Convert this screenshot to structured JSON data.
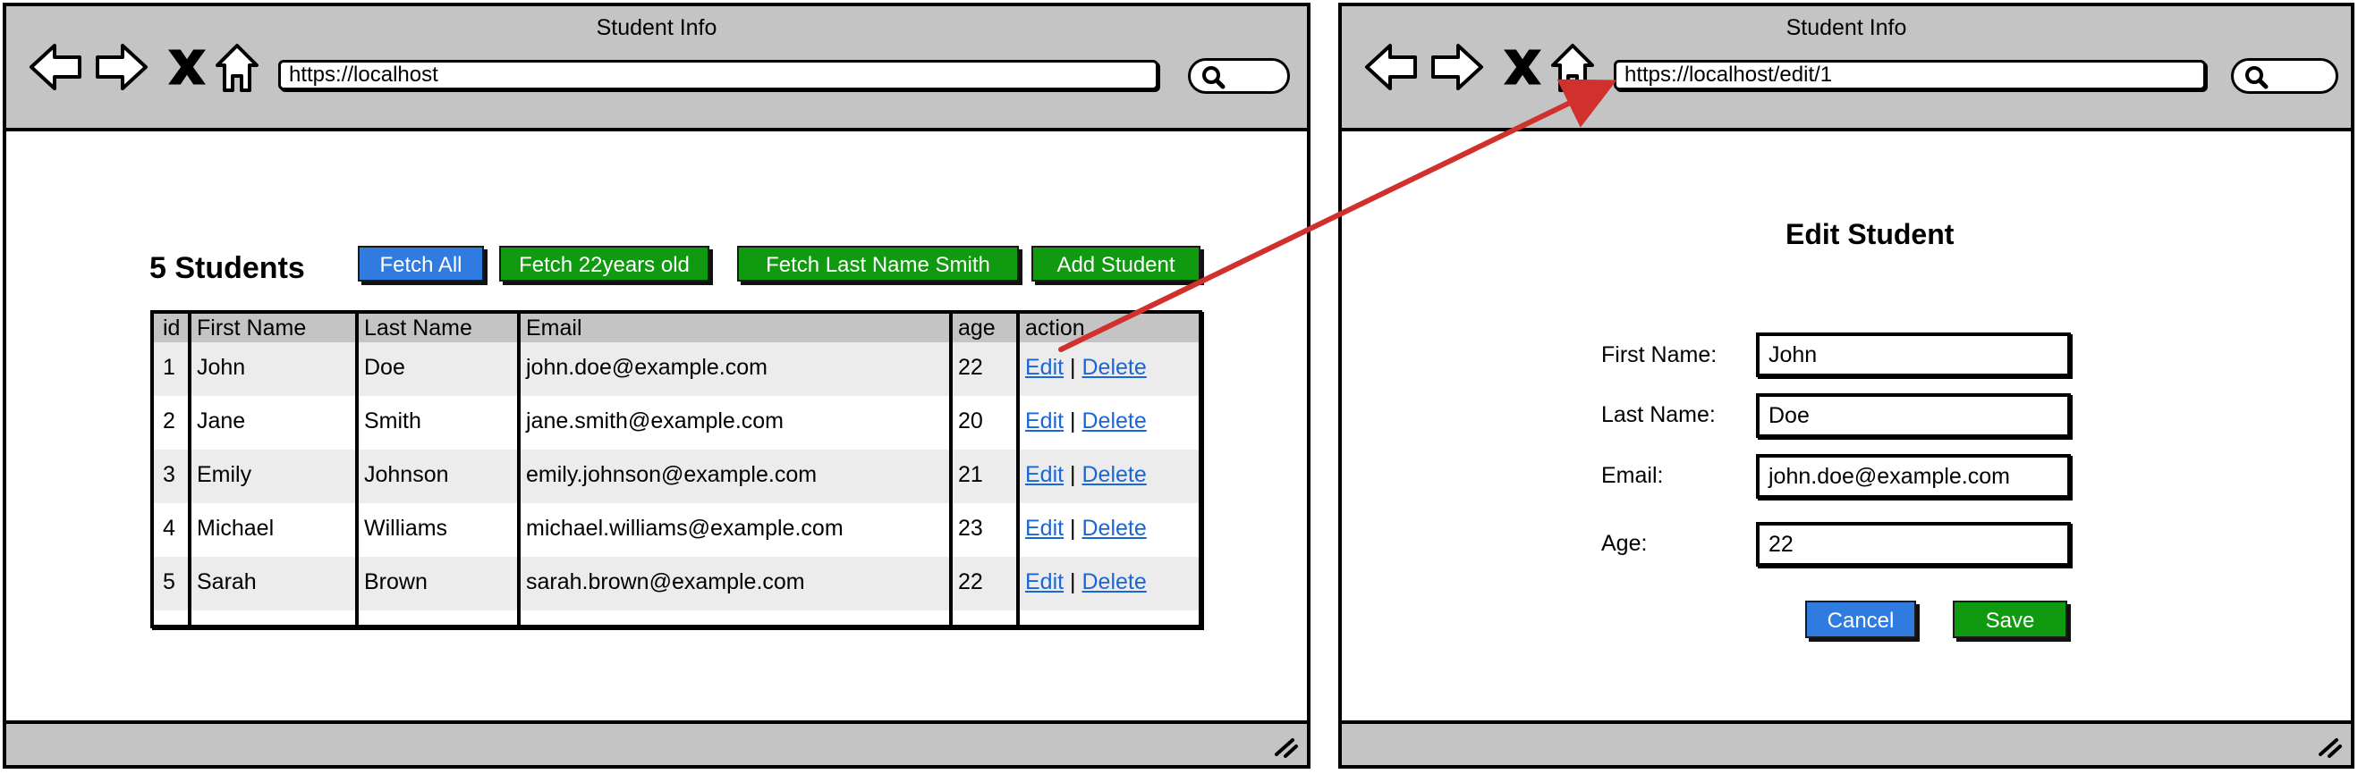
{
  "list_window": {
    "title": "Student Info",
    "url": "https://localhost",
    "heading": "5 Students",
    "buttons": {
      "fetch_all": "Fetch All",
      "fetch_22": "Fetch 22years old",
      "fetch_smith": "Fetch Last Name Smith",
      "add_student": "Add Student"
    },
    "table": {
      "columns": [
        "id",
        "First Name",
        "Last Name",
        "Email",
        "age",
        "action"
      ],
      "rows": [
        {
          "id": "1",
          "first": "John",
          "last": "Doe",
          "email": "john.doe@example.com",
          "age": "22"
        },
        {
          "id": "2",
          "first": "Jane",
          "last": "Smith",
          "email": "jane.smith@example.com",
          "age": "20"
        },
        {
          "id": "3",
          "first": "Emily",
          "last": "Johnson",
          "email": "emily.johnson@example.com",
          "age": "21"
        },
        {
          "id": "4",
          "first": "Michael",
          "last": "Williams",
          "email": "michael.williams@example.com",
          "age": "23"
        },
        {
          "id": "5",
          "first": "Sarah",
          "last": "Brown",
          "email": "sarah.brown@example.com",
          "age": "22"
        }
      ],
      "edit_label": "Edit",
      "separator": "|",
      "delete_label": "Delete"
    }
  },
  "edit_window": {
    "title": "Student Info",
    "url": "https://localhost/edit/1",
    "heading": "Edit Student",
    "labels": {
      "first": "First Name:",
      "last": "Last Name:",
      "email": "Email:",
      "age": "Age:"
    },
    "values": {
      "first": "John",
      "last": "Doe",
      "email": "john.doe@example.com",
      "age": "22"
    },
    "buttons": {
      "cancel": "Cancel",
      "save": "Save"
    }
  },
  "colors": {
    "chrome": "#c4c4c4",
    "primary_button": "#2f7be0",
    "success_button": "#0f9a0f",
    "link": "#1a66d6",
    "arrow": "#d0312d",
    "row_stripe": "#ececec"
  },
  "icons": [
    "back-arrow-icon",
    "forward-arrow-icon",
    "close-icon",
    "home-icon",
    "search-icon",
    "resize-grip-icon"
  ]
}
